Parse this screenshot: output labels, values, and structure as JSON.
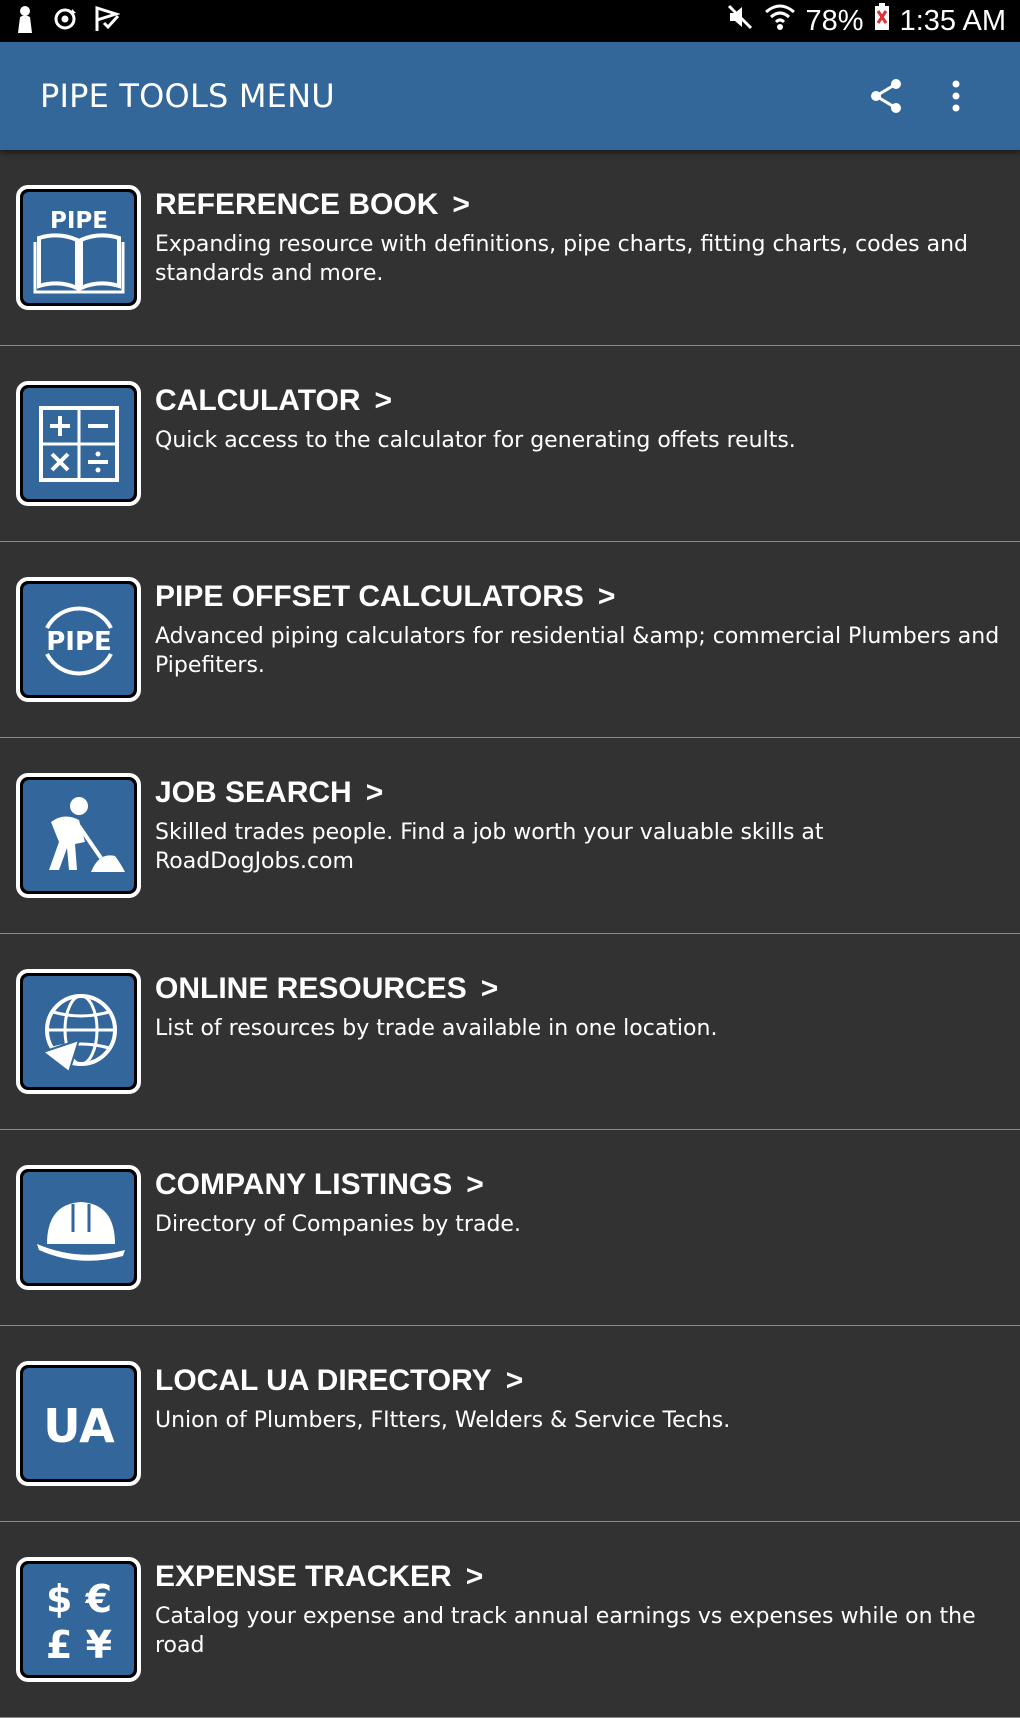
{
  "status_bar": {
    "left_icons": [
      "person-icon",
      "sync-icon",
      "check-flag-icon"
    ],
    "right_icons": [
      "mute-icon",
      "wifi-icon"
    ],
    "battery_percent": "78%",
    "time": "1:35 AM"
  },
  "app_bar": {
    "title": "PIPE TOOLS MENU",
    "actions": [
      "share-icon",
      "more-vert-icon"
    ],
    "color": "#336699"
  },
  "menu": {
    "chevron": ">",
    "items": [
      {
        "title": "REFERENCE BOOK",
        "description": "Expanding resource with definitions, pipe charts, fitting charts, codes and standards and more.",
        "icon": "pipe-book-icon",
        "icon_label": "PIPE"
      },
      {
        "title": "CALCULATOR",
        "description": "Quick access to the calculator for generating offets reults.",
        "icon": "calculator-icon"
      },
      {
        "title": "PIPE OFFSET CALCULATORS",
        "description": "Advanced piping calculators for residential &amp; commercial Plumbers and Pipefiters.",
        "icon": "pipe-circle-icon",
        "icon_label": "PIPE"
      },
      {
        "title": "JOB SEARCH",
        "description": "Skilled trades people. Find a job worth your valuable skills at RoadDogJobs.com",
        "icon": "worker-shovel-icon"
      },
      {
        "title": "ONLINE RESOURCES",
        "description": "List of resources by trade available in one location.",
        "icon": "globe-icon"
      },
      {
        "title": "COMPANY LISTINGS",
        "description": "Directory of Companies by trade.",
        "icon": "hard-hat-icon"
      },
      {
        "title": "LOCAL UA DIRECTORY",
        "description": "Union of Plumbers, FItters, Welders & Service Techs.",
        "icon": "ua-logo-icon",
        "icon_label": "UA"
      },
      {
        "title": "EXPENSE TRACKER",
        "description": "Catalog your expense and track annual earnings vs expenses while on the road",
        "icon": "currency-icon",
        "icon_label": "$ €"
      }
    ]
  }
}
